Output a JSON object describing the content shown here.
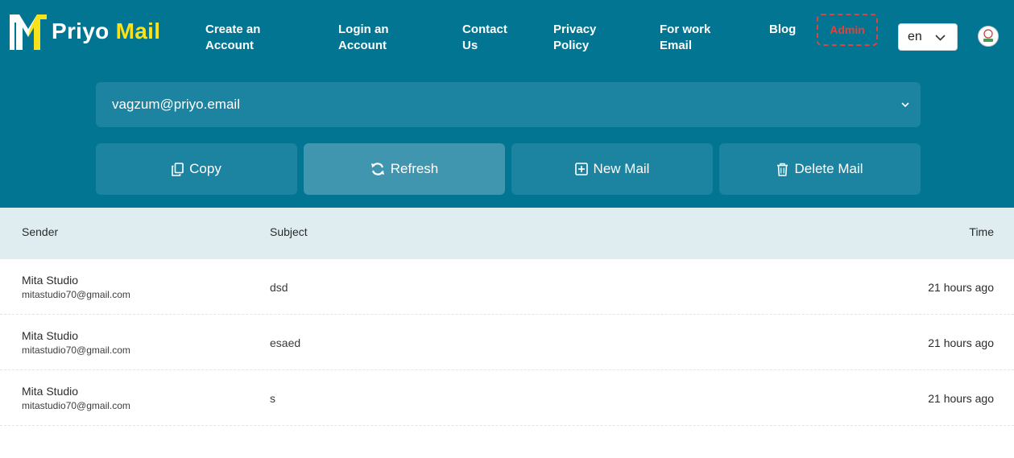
{
  "brand": {
    "name_part1": "Priyo",
    "name_part2": "Mail"
  },
  "nav": {
    "create_account": [
      "Create an",
      "Account"
    ],
    "login_account": [
      "Login an",
      "Account"
    ],
    "contact_us": [
      "Contact",
      "Us"
    ],
    "privacy_policy": [
      "Privacy",
      "Policy"
    ],
    "work_email": [
      "For work",
      "Email"
    ],
    "blog": "Blog",
    "admin": "Admin"
  },
  "language": {
    "selected": "en"
  },
  "mailbox": {
    "selected_email": "vagzum@priyo.email"
  },
  "actions": {
    "copy": "Copy",
    "refresh": "Refresh",
    "new_mail": "New Mail",
    "delete_mail": "Delete Mail"
  },
  "table": {
    "headers": {
      "sender": "Sender",
      "subject": "Subject",
      "time": "Time"
    },
    "rows": [
      {
        "sender_name": "Mita Studio",
        "sender_email": "mitastudio70@gmail.com",
        "subject": "dsd",
        "time": "21 hours ago"
      },
      {
        "sender_name": "Mita Studio",
        "sender_email": "mitastudio70@gmail.com",
        "subject": "esaed",
        "time": "21 hours ago"
      },
      {
        "sender_name": "Mita Studio",
        "sender_email": "mitastudio70@gmail.com",
        "subject": "s",
        "time": "21 hours ago"
      }
    ]
  },
  "colors": {
    "header_bg": "#027592",
    "control_bg": "#1c83a0",
    "active_button_bg": "#4096ae",
    "brand_yellow": "#f7e21b",
    "admin_red": "#e0433a",
    "table_head_bg": "#dfedf0"
  }
}
